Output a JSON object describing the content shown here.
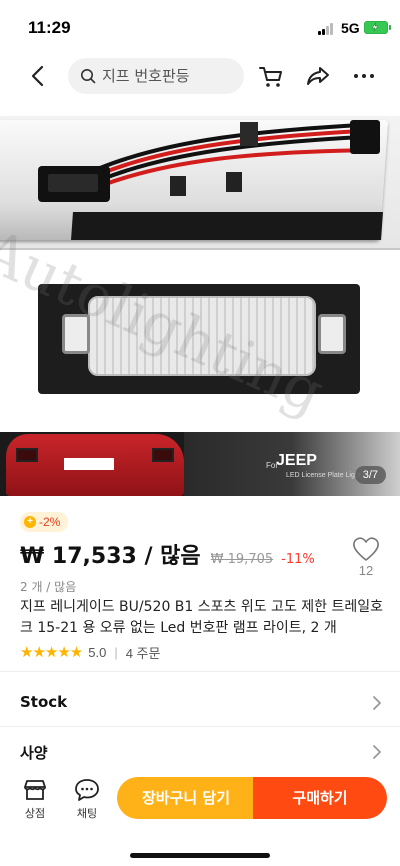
{
  "status_bar": {
    "time": "11:29",
    "network": "5G",
    "icons": [
      "signal-icon",
      "battery-charging-icon"
    ]
  },
  "header": {
    "search_placeholder": "지프 번호판등",
    "icons": [
      "back-arrow-icon",
      "search-icon",
      "cart-icon",
      "share-icon",
      "more-icon"
    ]
  },
  "gallery": {
    "counter": "3/7",
    "watermark": "Autolighting",
    "brand": "JEEP",
    "brand_prefix": "For",
    "brand_sub": "LED License Plate Light"
  },
  "product": {
    "discount_badge": "-2%",
    "price": "₩ 17,533 / 많음",
    "original_price": "₩ 19,705",
    "discount": "-11%",
    "wishlist_count": "12",
    "unit": "2 개 / 많음",
    "title": "지프 레니게이드 BU/520 B1 스포츠 위도 고도 제한 트레일호크 15-21 용 오류 없는 Led 번호판 램프 라이트, 2 개",
    "rating": "5.0",
    "stars": 5,
    "orders": "4 주문"
  },
  "sections": {
    "stock": "Stock",
    "specs": "사양"
  },
  "bottom_bar": {
    "store_label": "상점",
    "chat_label": "채팅",
    "add_to_cart": "장바구니 담기",
    "buy_now": "구매하기"
  },
  "colors": {
    "accent_orange": "#ff4a12",
    "cart_yellow": "#ffb218",
    "discount_red": "#ff3a2f",
    "star": "#ffb400"
  }
}
